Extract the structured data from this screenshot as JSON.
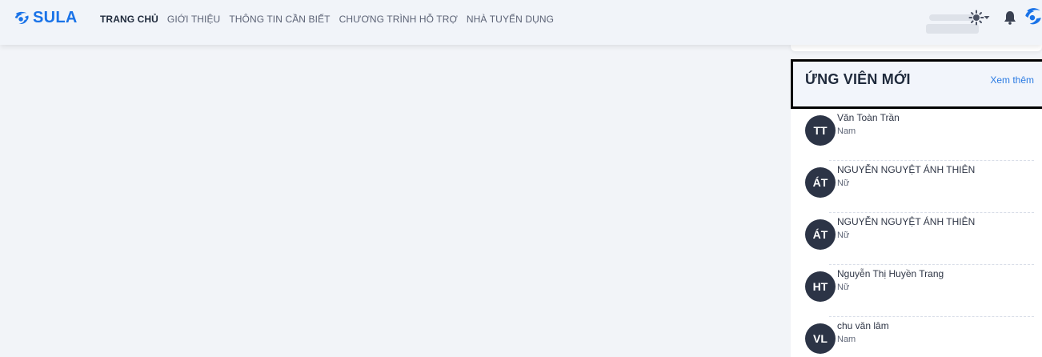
{
  "brand": {
    "name": "SULA",
    "color": "#1a73e8"
  },
  "nav": {
    "items": [
      {
        "label": "TRANG CHỦ",
        "active": true
      },
      {
        "label": "GIỚI THIỆU",
        "active": false
      },
      {
        "label": "THÔNG TIN CẦN BIẾT",
        "active": false
      },
      {
        "label": "CHƯƠNG TRÌNH HỖ TRỢ",
        "active": false
      },
      {
        "label": "NHÀ TUYỂN DỤNG",
        "active": false
      }
    ]
  },
  "tools": {
    "theme_icon": "sun-icon",
    "dropdown_icon": "caret-down-icon",
    "notification_icon": "bell-icon",
    "profile_icon": "brand-logo-icon"
  },
  "panel": {
    "title": "ỨNG VIÊN MỚI",
    "see_more": "Xem thêm",
    "candidates": [
      {
        "initials": "TT",
        "name": "Văn Toàn Trần",
        "gender": "Nam"
      },
      {
        "initials": "ÁT",
        "name": "NGUYỄN NGUYỆT ÁNH THIÊN",
        "gender": "Nữ"
      },
      {
        "initials": "ÁT",
        "name": "NGUYỄN NGUYỆT ÁNH THIÊN",
        "gender": "Nữ"
      },
      {
        "initials": "HT",
        "name": "Nguyễn Thị Huyền Trang",
        "gender": "Nữ"
      },
      {
        "initials": "VL",
        "name": "chu văn lâm",
        "gender": "Nam"
      }
    ]
  }
}
